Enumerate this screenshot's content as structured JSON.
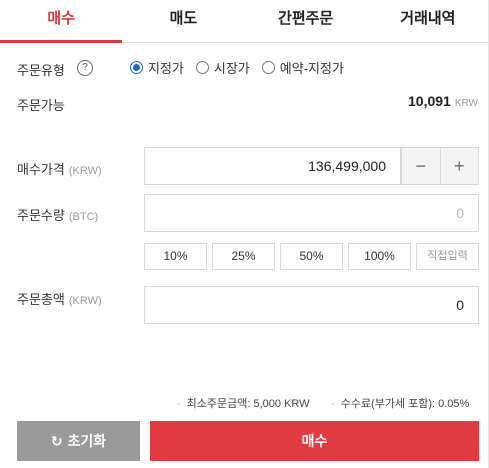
{
  "tabs": [
    {
      "label": "매수",
      "active": true
    },
    {
      "label": "매도",
      "active": false
    },
    {
      "label": "간편주문",
      "active": false
    },
    {
      "label": "거래내역",
      "active": false
    }
  ],
  "order_type": {
    "label": "주문유형",
    "help_icon": "?",
    "options": [
      "지정가",
      "시장가",
      "예약-지정가"
    ],
    "selected": "지정가"
  },
  "available": {
    "label": "주문가능",
    "value": "10,091",
    "unit": "KRW"
  },
  "price": {
    "label": "매수가격",
    "unit": "(KRW)",
    "value": "136,499,000",
    "minus": "−",
    "plus": "+"
  },
  "quantity": {
    "label": "주문수량",
    "unit": "(BTC)",
    "placeholder": "0"
  },
  "percent_buttons": [
    "10%",
    "25%",
    "50%",
    "100%"
  ],
  "direct_input_label": "직접입력",
  "total": {
    "label": "주문총액",
    "unit": "(KRW)",
    "value": "0"
  },
  "info": {
    "min_order": "최소주문금액: 5,000 KRW",
    "fee": "수수료(부가세 포함): 0.05%"
  },
  "buttons": {
    "reset_icon": "↻",
    "reset_label": "초기화",
    "buy_label": "매수"
  },
  "colors": {
    "accent": "#d63a3a",
    "buy": "#e13b41",
    "reset": "#9a9a9a",
    "radio": "#1e64d2"
  }
}
